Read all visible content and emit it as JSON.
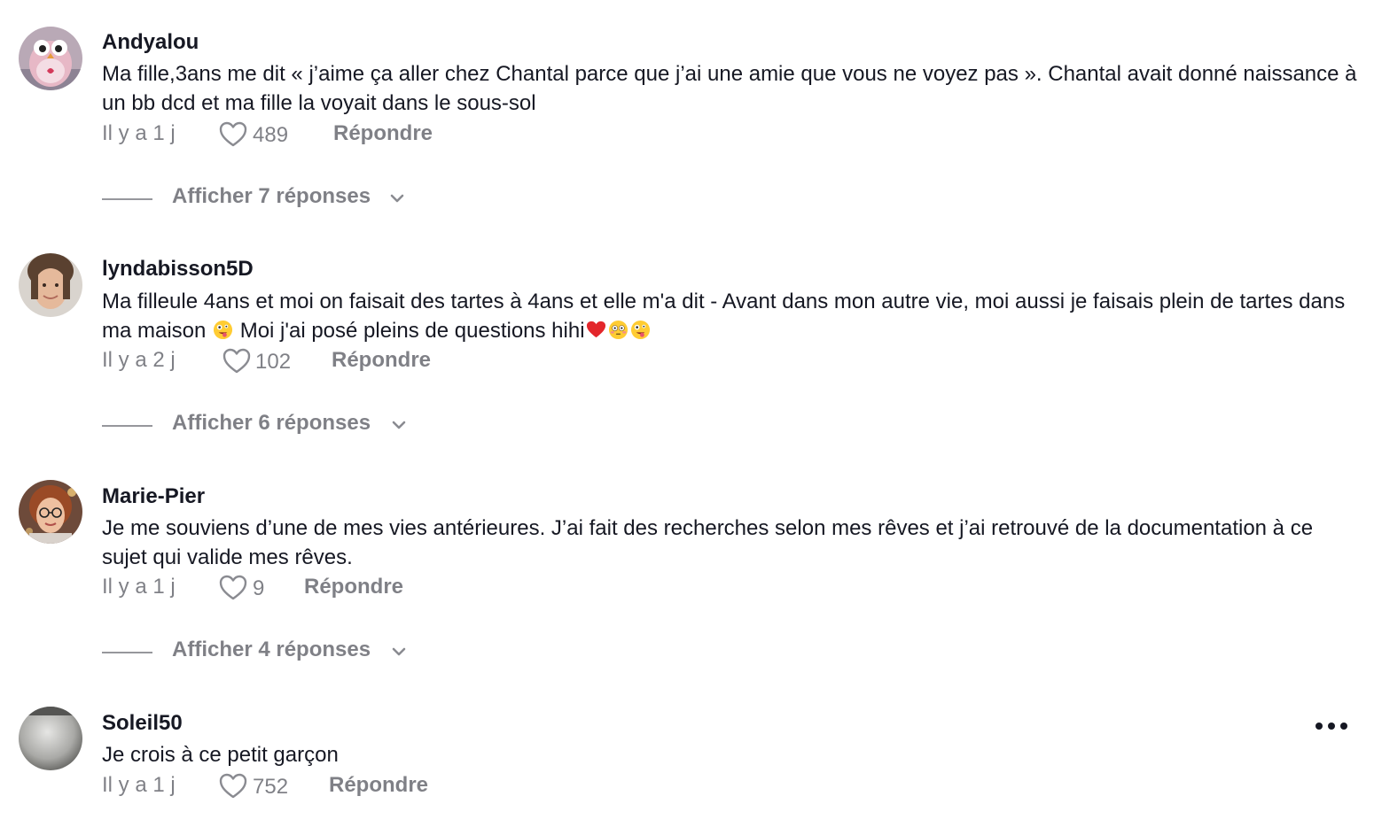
{
  "comments": [
    {
      "username": "Andyalou",
      "text": "Ma fille,3ans me dit « j’aime ça aller chez Chantal parce que j’ai une amie que vous ne voyez pas ». Chantal avait donné naissance à un bb dcd et ma fille la voyait dans le sous-sol",
      "time": "Il y a 1 j",
      "likes": "489",
      "reply_label": "Répondre",
      "view_replies": "Afficher 7 réponses",
      "avatar_icon": "owl-plush-avatar"
    },
    {
      "username": "lyndabisson5D",
      "text_part1": "Ma filleule 4ans et moi on faisait des tartes à 4ans et elle m'a dit - Avant dans mon autre vie, moi aussi je faisais plein de tartes dans ma maison",
      "text_part2": "Moi j'ai posé pleins de questions hihi",
      "emojis": [
        "zany-face",
        "red-heart",
        "flushed-face",
        "zany-face"
      ],
      "time": "Il y a 2 j",
      "likes": "102",
      "reply_label": "Répondre",
      "view_replies": "Afficher 6 réponses",
      "avatar_icon": "woman-portrait-avatar"
    },
    {
      "username": "Marie-Pier",
      "text": "Je me souviens d’une de mes vies antérieures. J’ai fait des recherches selon mes rêves et j’ai retrouvé de la documentation à ce sujet qui valide mes rêves.",
      "time": "Il y a 1 j",
      "likes": "9",
      "reply_label": "Répondre",
      "view_replies": "Afficher 4 réponses",
      "avatar_icon": "woman-glasses-avatar"
    },
    {
      "username": "Soleil50",
      "text": "Je crois à ce petit garçon",
      "time": "Il y a 1 j",
      "likes": "752",
      "reply_label": "Répondre",
      "avatar_icon": "grey-photo-avatar",
      "more_icon": "more-options-icon"
    }
  ],
  "colors": {
    "text_primary": "#161823",
    "text_secondary": "#8a8b91",
    "background": "#ffffff"
  }
}
